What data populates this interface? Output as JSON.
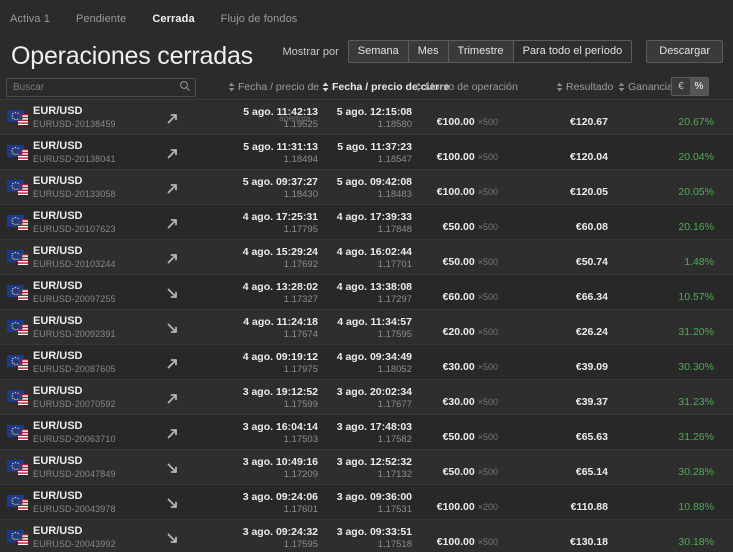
{
  "tabs": [
    {
      "label": "Activa 1",
      "active": false
    },
    {
      "label": "Pendiente",
      "active": false
    },
    {
      "label": "Cerrada",
      "active": true
    },
    {
      "label": "Flujo de fondos",
      "active": false
    }
  ],
  "header": {
    "title": "Operaciones cerradas",
    "show_by_label": "Mostrar por",
    "periods": [
      {
        "label": "Semana",
        "selected": false
      },
      {
        "label": "Mes",
        "selected": false
      },
      {
        "label": "Trimestre",
        "selected": false
      },
      {
        "label": "Para todo el período",
        "selected": true
      }
    ],
    "download_label": "Descargar"
  },
  "search": {
    "placeholder": "Buscar",
    "value": "",
    "icon": "search-icon"
  },
  "columns": {
    "open": "Fecha / precio de",
    "close": "Fecha / precio de cierre",
    "amount": "Monto de operación",
    "result": "Resultado",
    "profit": "Ganancia",
    "unit_currency": "€",
    "unit_percent": "%",
    "unit_selected": "%"
  },
  "overlay": {
    "tooltip_apertura": "apertura"
  },
  "colors": {
    "profit_green": "#4caf50",
    "background": "#2b2b2b",
    "row": "#2e2e2e",
    "row_alt": "#282828"
  },
  "rows": [
    {
      "pair": "EUR/USD",
      "ticket": "EURUSD-20138459",
      "direction": "up",
      "open_date": "5 ago. 11:42:13",
      "open_price": "1.19525",
      "close_date": "5 ago. 12:15:08",
      "close_price": "1.18580",
      "amount": "€100.00",
      "multiplier": "×500",
      "result": "€120.67",
      "profit": "20.67%"
    },
    {
      "pair": "EUR/USD",
      "ticket": "EURUSD-20138041",
      "direction": "up",
      "open_date": "5 ago. 11:31:13",
      "open_price": "1.18494",
      "close_date": "5 ago. 11:37:23",
      "close_price": "1.18547",
      "amount": "€100.00",
      "multiplier": "×500",
      "result": "€120.04",
      "profit": "20.04%"
    },
    {
      "pair": "EUR/USD",
      "ticket": "EURUSD-20133058",
      "direction": "up",
      "open_date": "5 ago. 09:37:27",
      "open_price": "1.18430",
      "close_date": "5 ago. 09:42:08",
      "close_price": "1.18483",
      "amount": "€100.00",
      "multiplier": "×500",
      "result": "€120.05",
      "profit": "20.05%"
    },
    {
      "pair": "EUR/USD",
      "ticket": "EURUSD-20107623",
      "direction": "up",
      "open_date": "4 ago. 17:25:31",
      "open_price": "1.17795",
      "close_date": "4 ago. 17:39:33",
      "close_price": "1.17848",
      "amount": "€50.00",
      "multiplier": "×500",
      "result": "€60.08",
      "profit": "20.16%"
    },
    {
      "pair": "EUR/USD",
      "ticket": "EURUSD-20103244",
      "direction": "up",
      "open_date": "4 ago. 15:29:24",
      "open_price": "1.17692",
      "close_date": "4 ago. 16:02:44",
      "close_price": "1.17701",
      "amount": "€50.00",
      "multiplier": "×500",
      "result": "€50.74",
      "profit": "1.48%"
    },
    {
      "pair": "EUR/USD",
      "ticket": "EURUSD-20097255",
      "direction": "down",
      "open_date": "4 ago. 13:28:02",
      "open_price": "1.17327",
      "close_date": "4 ago. 13:38:08",
      "close_price": "1.17297",
      "amount": "€60.00",
      "multiplier": "×500",
      "result": "€66.34",
      "profit": "10.57%"
    },
    {
      "pair": "EUR/USD",
      "ticket": "EURUSD-20092391",
      "direction": "down",
      "open_date": "4 ago. 11:24:18",
      "open_price": "1.17674",
      "close_date": "4 ago. 11:34:57",
      "close_price": "1.17595",
      "amount": "€20.00",
      "multiplier": "×500",
      "result": "€26.24",
      "profit": "31.20%"
    },
    {
      "pair": "EUR/USD",
      "ticket": "EURUSD-20087605",
      "direction": "up",
      "open_date": "4 ago. 09:19:12",
      "open_price": "1.17975",
      "close_date": "4 ago. 09:34:49",
      "close_price": "1.18052",
      "amount": "€30.00",
      "multiplier": "×500",
      "result": "€39.09",
      "profit": "30.30%"
    },
    {
      "pair": "EUR/USD",
      "ticket": "EURUSD-20070592",
      "direction": "up",
      "open_date": "3 ago. 19:12:52",
      "open_price": "1.17599",
      "close_date": "3 ago. 20:02:34",
      "close_price": "1.17677",
      "amount": "€30.00",
      "multiplier": "×500",
      "result": "€39.37",
      "profit": "31.23%"
    },
    {
      "pair": "EUR/USD",
      "ticket": "EURUSD-20063710",
      "direction": "up",
      "open_date": "3 ago. 16:04:14",
      "open_price": "1.17503",
      "close_date": "3 ago. 17:48:03",
      "close_price": "1.17582",
      "amount": "€50.00",
      "multiplier": "×500",
      "result": "€65.63",
      "profit": "31.26%"
    },
    {
      "pair": "EUR/USD",
      "ticket": "EURUSD-20047849",
      "direction": "down",
      "open_date": "3 ago. 10:49:16",
      "open_price": "1.17209",
      "close_date": "3 ago. 12:52:32",
      "close_price": "1.17132",
      "amount": "€50.00",
      "multiplier": "×500",
      "result": "€65.14",
      "profit": "30.28%"
    },
    {
      "pair": "EUR/USD",
      "ticket": "EURUSD-20043978",
      "direction": "down",
      "open_date": "3 ago. 09:24:06",
      "open_price": "1.17601",
      "close_date": "3 ago. 09:36:00",
      "close_price": "1.17531",
      "amount": "€100.00",
      "multiplier": "×200",
      "result": "€110.88",
      "profit": "10.88%"
    },
    {
      "pair": "EUR/USD",
      "ticket": "EURUSD-20043992",
      "direction": "down",
      "open_date": "3 ago. 09:24:32",
      "open_price": "1.17595",
      "close_date": "3 ago. 09:33:51",
      "close_price": "1.17518",
      "amount": "€100.00",
      "multiplier": "×500",
      "result": "€130.18",
      "profit": "30.18%"
    }
  ]
}
